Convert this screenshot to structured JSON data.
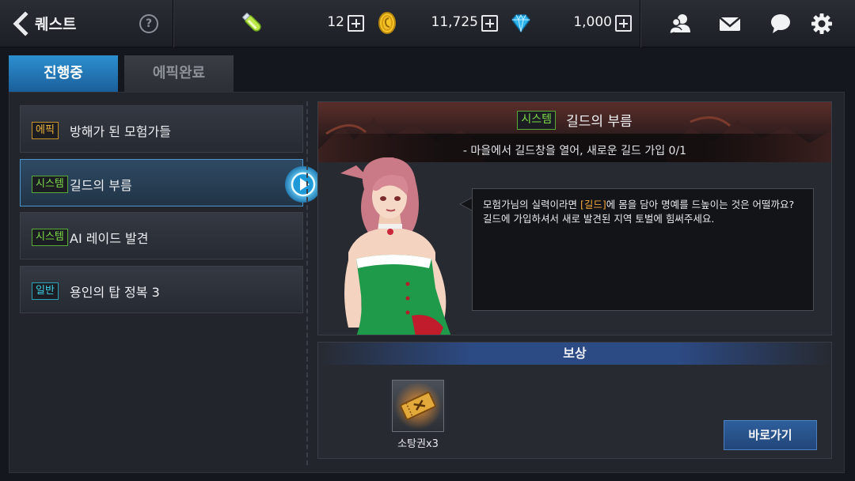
{
  "header": {
    "title": "퀘스트",
    "help_label": "?",
    "stamina": "12",
    "gold": "11,725",
    "gems": "1,000"
  },
  "tabs": [
    {
      "label": "진행중",
      "active": true
    },
    {
      "label": "에픽완료",
      "active": false
    }
  ],
  "quests": [
    {
      "tag": "에픽",
      "name": "방해가 된 모험가들",
      "type": "epic"
    },
    {
      "tag": "시스템",
      "name": "길드의 부름",
      "type": "system",
      "selected": true
    },
    {
      "tag": "시스템",
      "name": "AI 레이드 발견",
      "type": "system"
    },
    {
      "tag": "일반",
      "name": "용인의 탑 정복 3",
      "type": "normal"
    }
  ],
  "detail": {
    "tag": "시스템",
    "title": "길드의 부름",
    "objective": "- 마을에서 길드창을 열어, 새로운 길드 가입 0/1",
    "dialog_pre": "모험가님의 실력이라면 ",
    "dialog_highlight": "[길드]",
    "dialog_post": "에 몸을 담아 명예를 드높이는 것은 어떨까요?  길드에 가입하셔서 새로 발견된 지역 토벌에 힘써주세요."
  },
  "reward": {
    "heading": "보상",
    "item_label": "소탕권x3",
    "goto_label": "바로가기"
  },
  "colors": {
    "active_tab": "#2d8fd0",
    "epic_tag": "#f0b43c",
    "system_tag": "#7ddc48",
    "normal_tag": "#3fd0e8",
    "dialog_highlight": "#f0a53a"
  },
  "icons": [
    "back-arrow-icon",
    "help-icon",
    "stamina-potion-icon",
    "gold-coin-icon",
    "diamond-icon",
    "friends-icon",
    "mail-icon",
    "chat-icon",
    "settings-gear-icon",
    "play-arrow-icon",
    "ticket-icon"
  ]
}
